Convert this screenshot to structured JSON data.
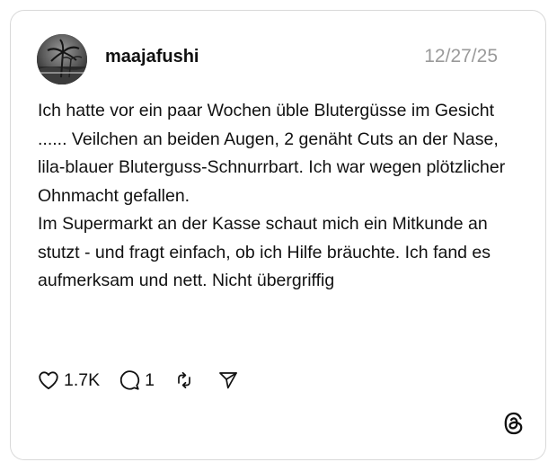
{
  "post": {
    "username": "maajafushi",
    "date": "12/27/25",
    "paragraphs": [
      "Ich hatte vor ein paar Wochen üble Blutergüsse im Gesicht ...... Veilchen an beiden Augen, 2 genäht Cuts an der Nase, lila-blauer Bluterguss-Schnurrbart. Ich war wegen plötzlicher Ohnmacht gefallen.",
      "Im Supermarkt an der Kasse schaut mich ein Mitkunde an stutzt - und fragt einfach, ob ich Hilfe bräuchte. Ich fand es aufmerksam und nett. Nicht übergriffig"
    ]
  },
  "actions": {
    "like_count": "1.7K",
    "reply_count": "1",
    "icons": [
      "heart-icon",
      "comment-icon",
      "repost-icon",
      "share-icon"
    ]
  },
  "brand": {
    "logo": "threads-logo",
    "text_color": "#111111",
    "date_color": "#9a9a9a",
    "border_color": "#d9d9d9"
  }
}
